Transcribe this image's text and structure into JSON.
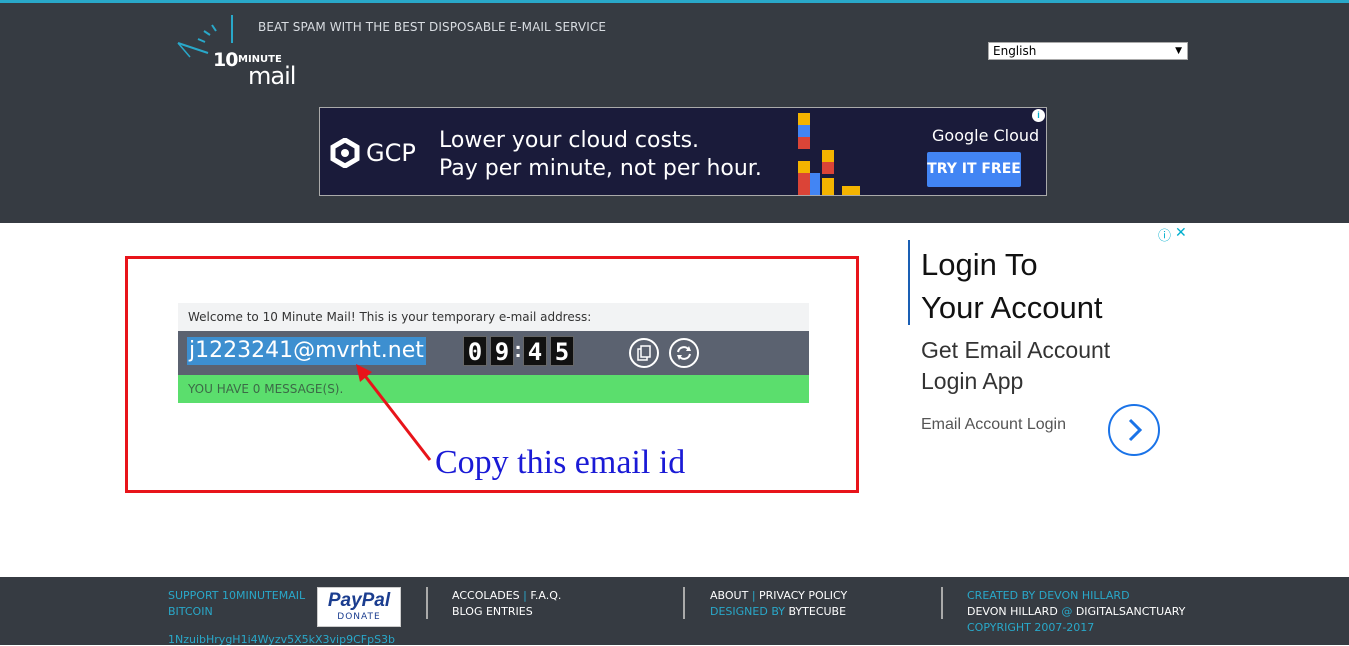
{
  "header": {
    "logo": {
      "ten": "10",
      "minute": "MINUTE",
      "mail": "mail"
    },
    "tagline": "BEAT SPAM WITH THE BEST DISPOSABLE E-MAIL SERVICE",
    "language": {
      "selected": "English"
    }
  },
  "ad_banner": {
    "brand": "GCP",
    "line1": "Lower your cloud costs.",
    "line2": "Pay per minute, not per hour.",
    "company": "Google Cloud",
    "cta": "TRY IT FREE"
  },
  "mail": {
    "welcome": "Welcome to 10 Minute Mail! This is your temporary e-mail address:",
    "address": "j1223241@mvrht.net",
    "timer": {
      "d1": "0",
      "d2": "9",
      "d3": "4",
      "d4": "5"
    },
    "messages": "YOU HAVE 0 MESSAGE(S).",
    "annotation": "Copy this email id"
  },
  "side_ad": {
    "title_line1": "Login To",
    "title_line2": "Your Account",
    "sub_line1": "Get Email Account",
    "sub_line2": "Login App",
    "small": "Email Account Login"
  },
  "footer": {
    "support_line1": "SUPPORT 10MINUTEMAIL",
    "support_line2": "BITCOIN",
    "bitcoin_address": "1NzuibHrygH1i4Wyzv5X5kX3vip9CFpS3b",
    "paypal_brand": "PayPal",
    "paypal_donate": "DONATE",
    "accolades": "ACCOLADES",
    "faq": "F.A.Q.",
    "blog": "BLOG ENTRIES",
    "about": "ABOUT",
    "privacy": "PRIVACY POLICY",
    "designed_by": "DESIGNED BY",
    "bytecube": "BYTECUBE",
    "created_by": "CREATED BY DEVON HILLARD",
    "devon": "DEVON HILLARD",
    "at": "@",
    "digital": "DIGITALSANCTUARY",
    "copyright": "COPYRIGHT 2007-2017"
  },
  "colors": {
    "header_bg": "#363b42",
    "accent": "#29a8c9",
    "message_bar": "#5bde6d",
    "annotation_frame": "#e8141a"
  }
}
